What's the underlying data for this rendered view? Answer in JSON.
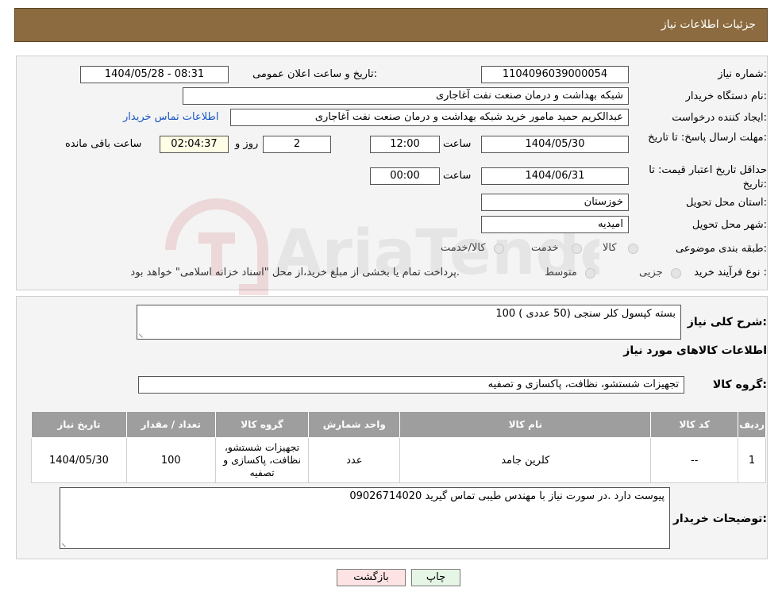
{
  "header": {
    "title": "جزئیات اطلاعات نیاز"
  },
  "form": {
    "need_number_label": "شماره نیاز:",
    "need_number": "1104096039000054",
    "announce_label": "تاریخ و ساعت اعلان عمومی:",
    "announce_value": "1404/05/28 - 08:31",
    "buyer_label": "نام دستگاه خریدار:",
    "buyer_value": "شبکه بهداشت و درمان صنعت نفت آغاجاری",
    "creator_label": "ایجاد کننده درخواست:",
    "creator_value": "عبدالکریم حمید مامور خرید شبکه بهداشت و درمان صنعت نفت آغاجاری",
    "contact_link": "اطلاعات تماس خریدار",
    "deadline_label": "مهلت ارسال پاسخ: تا تاریخ:",
    "deadline_date": "1404/05/30",
    "hour_label": "ساعت",
    "deadline_time": "12:00",
    "days_value": "2",
    "day_and": "روز و",
    "remaining_time": "02:04:37",
    "remaining_label": "ساعت باقی مانده",
    "validity_label": "حداقل تاریخ اعتبار قیمت: تا تاریخ:",
    "validity_date": "1404/06/31",
    "validity_time": "00:00",
    "province_label": "استان محل تحویل:",
    "province_value": "خوزستان",
    "city_label": "شهر محل تحویل:",
    "city_value": "امیدیه",
    "category_label": "طبقه بندی موضوعی:",
    "category_options": [
      "کالا",
      "خدمت",
      "کالا/خدمت"
    ],
    "process_label": "نوع فرآیند خرید :",
    "process_options": [
      "جزیی",
      "متوسط"
    ],
    "process_note": "پرداخت تمام یا بخشی از مبلغ خرید،از محل \"اسناد خزانه اسلامی\" خواهد بود."
  },
  "details": {
    "summary_label": "شرح کلی نیاز:",
    "summary_value": "100 بسته کپسول کلر سنجی (50 عددی )",
    "goods_title": "اطلاعات کالاهای مورد نیاز",
    "group_label": "گروه کالا:",
    "group_value": "تجهیزات شستشو، نظافت، پاکسازی و تصفیه",
    "table": {
      "headers": [
        "ردیف",
        "کد کالا",
        "نام کالا",
        "واحد شمارش",
        "گروه کالا",
        "تعداد / مقدار",
        "تاریخ نیاز"
      ],
      "rows": [
        [
          "1",
          "--",
          "کلرین جامد",
          "عدد",
          "تجهیزات شستشو، نظافت، پاکسازی و تصفیه",
          "100",
          "1404/05/30"
        ]
      ]
    },
    "notes_label": "توضیحات خریدار:",
    "notes_value": "پیوست دارد .در سورت نیاز با مهندس طیبی تماس گیرید 09026714020"
  },
  "buttons": {
    "print": "چاپ",
    "back": "بازگشت"
  },
  "watermark": {
    "text": "AriaTender.neT"
  },
  "colors": {
    "header_bg": "#8b6b3f",
    "link": "#1a55c4",
    "back_btn_bg": "#fde3e3",
    "print_btn_bg": "#e6f6e6"
  }
}
